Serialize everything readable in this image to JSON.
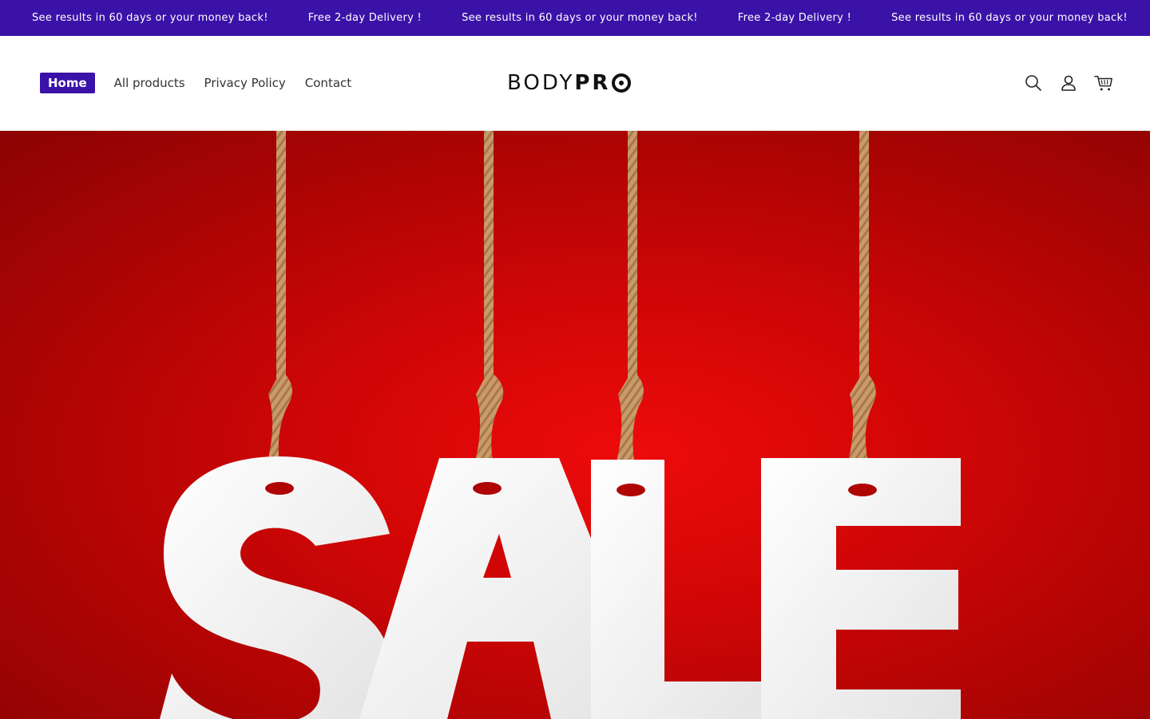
{
  "announcement": {
    "items": [
      "See results in 60 days or your money back!",
      "Free 2-day Delivery !",
      "See results in 60 days or your money back!",
      "Free 2-day Delivery !",
      "See results in 60 days or your money back!"
    ],
    "background": "#3a12a8"
  },
  "nav": {
    "items": [
      {
        "label": "Home",
        "active": true
      },
      {
        "label": "All products",
        "active": false
      },
      {
        "label": "Privacy Policy",
        "active": false
      },
      {
        "label": "Contact",
        "active": false
      }
    ]
  },
  "logo": {
    "light": "BODY",
    "bold": "PR"
  },
  "header_icons": [
    "search-icon",
    "account-icon",
    "cart-icon"
  ],
  "hero": {
    "letters": [
      "S",
      "A",
      "L",
      "E"
    ],
    "background": "#d00606"
  }
}
